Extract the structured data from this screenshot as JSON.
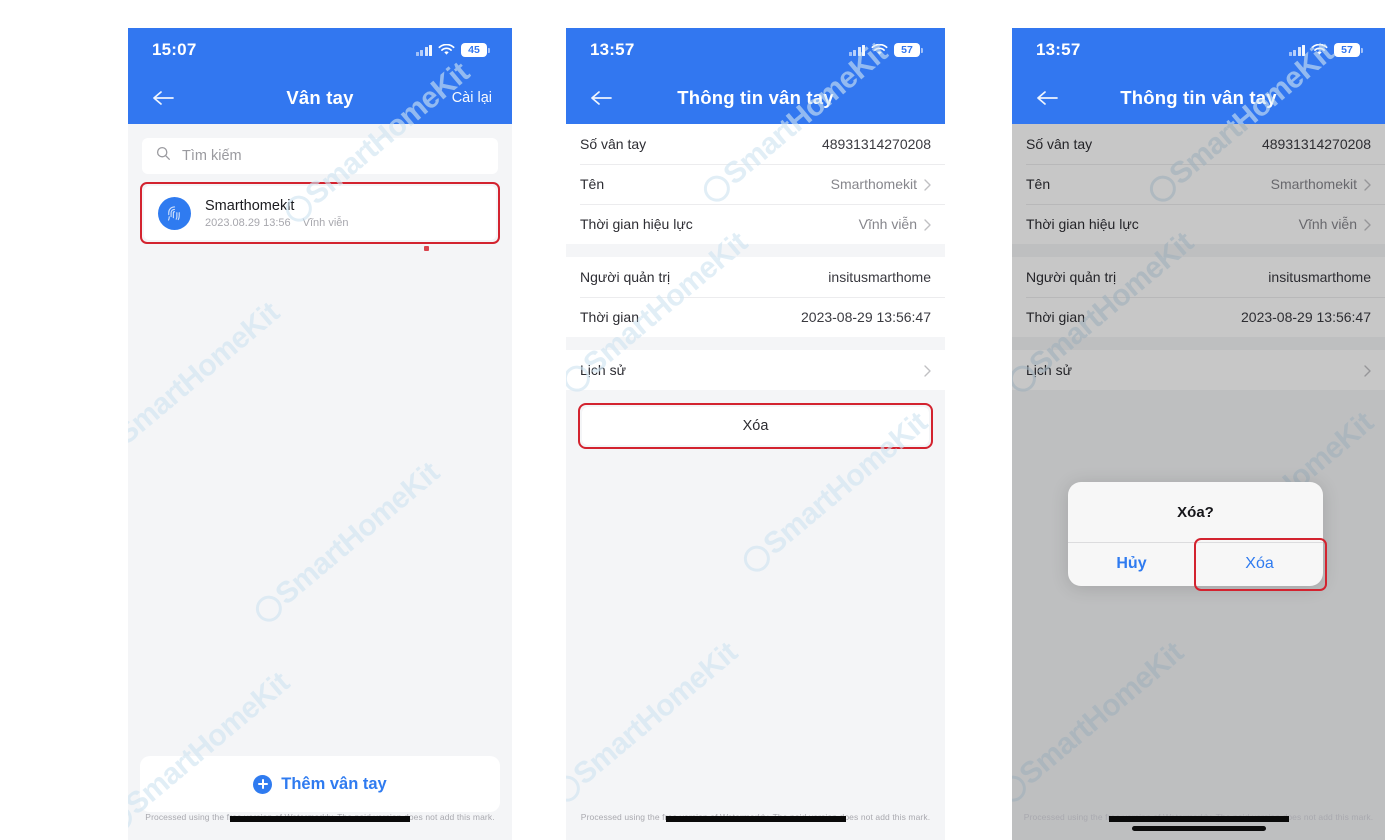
{
  "app": {
    "watermark_text": "SmartHomeKit",
    "footer_note": "Processed using the free version of Watermarkly. The paid version does not add this mark.",
    "accent_blue": "#3277F0",
    "highlight_red": "#d3232f"
  },
  "panel1": {
    "status": {
      "time": "15:07",
      "battery": "45",
      "wifi_icon": "wifi-icon",
      "signal_icon": "signal-bars-icon"
    },
    "nav": {
      "back_icon": "back-arrow-icon",
      "title": "Vân tay",
      "action": "Cài lại"
    },
    "search": {
      "icon": "search-icon",
      "placeholder": "Tìm kiếm"
    },
    "fingerprint": {
      "icon": "fingerprint-icon",
      "name": "Smarthomekit",
      "date": "2023.08.29 13:56",
      "validity": "Vĩnh viễn"
    },
    "add_button": {
      "icon": "plus-circle-icon",
      "label": "Thêm vân tay"
    }
  },
  "panel2": {
    "status": {
      "time": "13:57",
      "battery": "57",
      "wifi_icon": "wifi-icon",
      "signal_icon": "signal-bars-icon"
    },
    "nav": {
      "back_icon": "back-arrow-icon",
      "title": "Thông tin vân tay"
    },
    "rows": [
      {
        "label": "Số vân tay",
        "value": "48931314270208",
        "chevron": false
      },
      {
        "label": "Tên",
        "value": "Smarthomekit",
        "chevron": true
      },
      {
        "label": "Thời gian hiệu lực",
        "value": "Vĩnh viễn",
        "chevron": true
      },
      {
        "label": "Người quản trị",
        "value": "insitusmarthome",
        "chevron": false
      },
      {
        "label": "Thời gian",
        "value": "2023-08-29 13:56:47",
        "chevron": false
      },
      {
        "label": "Lịch sử",
        "value": "",
        "chevron": true
      }
    ],
    "delete_button": "Xóa"
  },
  "panel3": {
    "status": {
      "time": "13:57",
      "battery": "57",
      "wifi_icon": "wifi-icon",
      "signal_icon": "signal-bars-icon"
    },
    "nav": {
      "back_icon": "back-arrow-icon",
      "title": "Thông tin vân tay"
    },
    "rows": [
      {
        "label": "Số vân tay",
        "value": "48931314270208",
        "chevron": false
      },
      {
        "label": "Tên",
        "value": "Smarthomekit",
        "chevron": true
      },
      {
        "label": "Thời gian hiệu lực",
        "value": "Vĩnh viễn",
        "chevron": true
      },
      {
        "label": "Người quản trị",
        "value": "insitusmarthome",
        "chevron": false
      },
      {
        "label": "Thời gian",
        "value": "2023-08-29 13:56:47",
        "chevron": false
      },
      {
        "label": "Lịch sử",
        "value": "",
        "chevron": true
      }
    ],
    "alert": {
      "title": "Xóa?",
      "cancel": "Hủy",
      "confirm": "Xóa"
    }
  }
}
